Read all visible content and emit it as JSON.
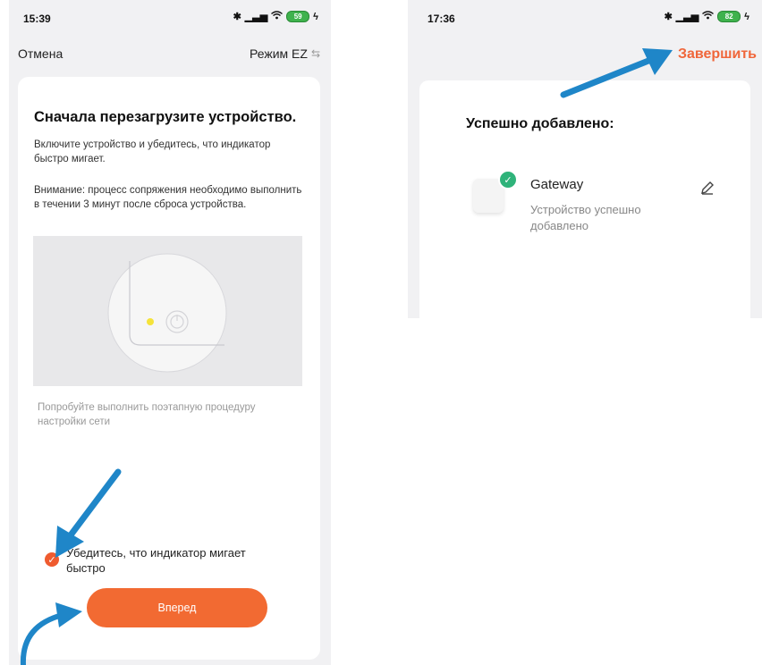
{
  "left_screen": {
    "status_time": "15:39",
    "battery": "59",
    "cancel_label": "Отмена",
    "mode_label": "Режим EZ",
    "title": "Сначала перезагрузите устройство.",
    "instruction": "Включите устройство и убедитесь, что индикатор быстро мигает.",
    "warning": "Внимание: процесс сопряжения необходимо выполнить в течении 3 минут после сброса устройства.",
    "hint": "Попробуйте выполнить поэтапную процедуру настройки сети",
    "confirm_label": "Убедитесь, что индикатор мигает быстро",
    "confirm_checked": true,
    "next_label": "Вперед"
  },
  "right_screen": {
    "status_time": "17:36",
    "battery": "82",
    "finish_label": "Завершить",
    "success_title": "Успешно добавлено:",
    "device_name": "Gateway",
    "device_status": "Устройство успешно добавлено"
  },
  "colors": {
    "accent_orange": "#f26a32",
    "success_green": "#2fb37a",
    "annotation_arrow": "#1f86c8",
    "indicator_yellow": "#f5e33a"
  },
  "icons": {
    "bluetooth": "bluetooth-icon",
    "signal": "signal-icon",
    "wifi": "wifi-icon",
    "charging": "charging-icon",
    "mode_switch": "swap-icon",
    "power": "power-icon",
    "check": "check-icon",
    "edit": "pencil-icon"
  }
}
